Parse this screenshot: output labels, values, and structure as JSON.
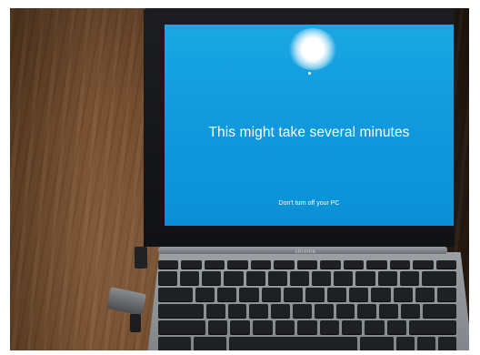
{
  "screen": {
    "title": "This might take several minutes",
    "subtitle": "Don't turn off your PC"
  },
  "laptop": {
    "brand": "chrome"
  },
  "colors": {
    "screen_blue": "#0f98dc",
    "bezel": "#111214",
    "wood": "#6b4529"
  }
}
